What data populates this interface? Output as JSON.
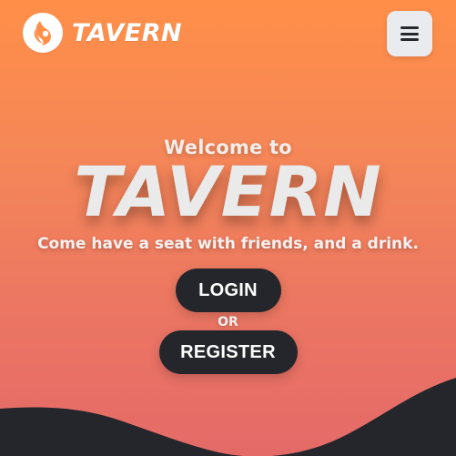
{
  "header": {
    "brand_name": "TAVERN",
    "logo_icon": "tavern-logo-icon",
    "menu_icon": "hamburger-menu-icon"
  },
  "hero": {
    "welcome_text": "Welcome to",
    "title": "TAVERN",
    "tagline": "Come have a seat with friends, and a drink.",
    "or_text": "OR"
  },
  "actions": {
    "login_label": "LOGIN",
    "register_label": "REGISTER"
  },
  "colors": {
    "gradient_top": "#ff8f48",
    "gradient_bottom": "#e46a68",
    "button_dark": "#25262b",
    "menu_button_bg": "#e9ebef",
    "wave": "#25262b"
  }
}
